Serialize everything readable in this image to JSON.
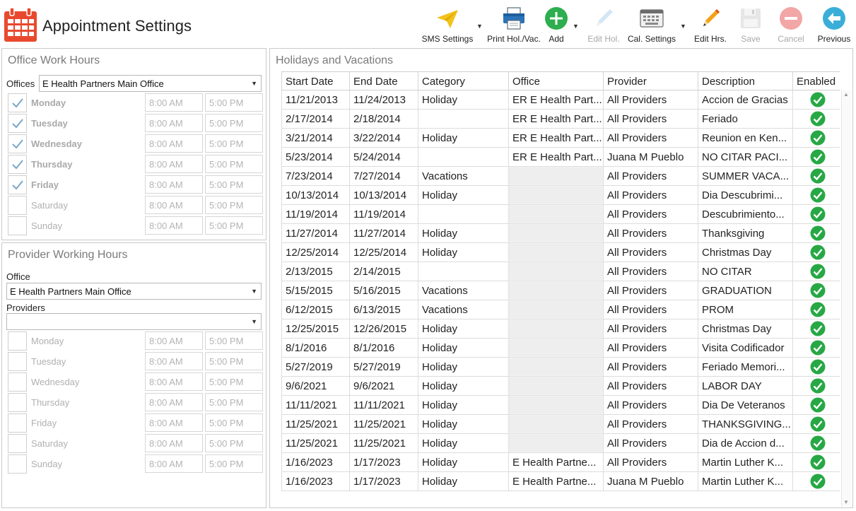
{
  "header": {
    "title": "Appointment Settings",
    "icon": "calendar-icon"
  },
  "toolbar": [
    {
      "label": "SMS Settings",
      "icon": "paper-plane-icon",
      "enabled": true,
      "has_dropdown": true
    },
    {
      "label": "Print Hol./Vac.",
      "icon": "printer-icon",
      "enabled": true,
      "has_dropdown": false
    },
    {
      "label": "Add",
      "icon": "add-circle-icon",
      "enabled": true,
      "has_dropdown": true
    },
    {
      "label": "Edit Hol.",
      "icon": "pencil-icon",
      "enabled": false,
      "has_dropdown": false
    },
    {
      "label": "Cal. Settings",
      "icon": "keyboard-icon",
      "enabled": true,
      "has_dropdown": true
    },
    {
      "label": "Edit Hrs.",
      "icon": "pencil-icon",
      "enabled": true,
      "has_dropdown": false
    },
    {
      "label": "Save",
      "icon": "floppy-disk-icon",
      "enabled": false,
      "has_dropdown": false
    },
    {
      "label": "Cancel",
      "icon": "minus-circle-icon",
      "enabled": false,
      "has_dropdown": false
    },
    {
      "label": "Previous",
      "icon": "arrow-left-circle-icon",
      "enabled": true,
      "has_dropdown": false
    }
  ],
  "office_hours": {
    "title": "Office Work Hours",
    "offices_label": "Offices",
    "office_selected": "E Health Partners Main Office",
    "days": [
      {
        "name": "Monday",
        "checked": true,
        "start": "8:00 AM",
        "end": "5:00 PM"
      },
      {
        "name": "Tuesday",
        "checked": true,
        "start": "8:00 AM",
        "end": "5:00 PM"
      },
      {
        "name": "Wednesday",
        "checked": true,
        "start": "8:00 AM",
        "end": "5:00 PM"
      },
      {
        "name": "Thursday",
        "checked": true,
        "start": "8:00 AM",
        "end": "5:00 PM"
      },
      {
        "name": "Friday",
        "checked": true,
        "start": "8:00 AM",
        "end": "5:00 PM"
      },
      {
        "name": "Saturday",
        "checked": false,
        "start": "8:00 AM",
        "end": "5:00 PM"
      },
      {
        "name": "Sunday",
        "checked": false,
        "start": "8:00 AM",
        "end": "5:00 PM"
      }
    ]
  },
  "provider_hours": {
    "title": "Provider Working Hours",
    "office_label": "Office",
    "office_selected": "E Health Partners Main Office",
    "providers_label": "Providers",
    "provider_selected": "",
    "days": [
      {
        "name": "Monday",
        "checked": false,
        "start": "8:00 AM",
        "end": "5:00 PM"
      },
      {
        "name": "Tuesday",
        "checked": false,
        "start": "8:00 AM",
        "end": "5:00 PM"
      },
      {
        "name": "Wednesday",
        "checked": false,
        "start": "8:00 AM",
        "end": "5:00 PM"
      },
      {
        "name": "Thursday",
        "checked": false,
        "start": "8:00 AM",
        "end": "5:00 PM"
      },
      {
        "name": "Friday",
        "checked": false,
        "start": "8:00 AM",
        "end": "5:00 PM"
      },
      {
        "name": "Saturday",
        "checked": false,
        "start": "8:00 AM",
        "end": "5:00 PM"
      },
      {
        "name": "Sunday",
        "checked": false,
        "start": "8:00 AM",
        "end": "5:00 PM"
      }
    ]
  },
  "holidays": {
    "title": "Holidays and Vacations",
    "columns": [
      "Start Date",
      "End Date",
      "Category",
      "Office",
      "Provider",
      "Description",
      "Enabled"
    ],
    "rows": [
      {
        "start": "11/21/2013",
        "end": "11/24/2013",
        "category": "Holiday",
        "office": "ER E Health Part...",
        "provider": "All Providers",
        "description": "Accion de Gracias",
        "enabled": true
      },
      {
        "start": "2/17/2014",
        "end": "2/18/2014",
        "category": "",
        "office": "ER E Health Part...",
        "provider": "All Providers",
        "description": "Feriado",
        "enabled": true
      },
      {
        "start": "3/21/2014",
        "end": "3/22/2014",
        "category": "Holiday",
        "office": "ER E Health Part...",
        "provider": "All Providers",
        "description": "Reunion en Ken...",
        "enabled": true
      },
      {
        "start": "5/23/2014",
        "end": "5/24/2014",
        "category": "",
        "office": "ER E Health Part...",
        "provider": "Juana M Pueblo",
        "description": "NO CITAR PACI...",
        "enabled": true
      },
      {
        "start": "7/23/2014",
        "end": "7/27/2014",
        "category": "Vacations",
        "office": "",
        "provider": "All Providers",
        "description": "SUMMER VACA...",
        "enabled": true
      },
      {
        "start": "10/13/2014",
        "end": "10/13/2014",
        "category": "Holiday",
        "office": "",
        "provider": "All Providers",
        "description": "Dia Descubrimi...",
        "enabled": true
      },
      {
        "start": "11/19/2014",
        "end": "11/19/2014",
        "category": "",
        "office": "",
        "provider": "All Providers",
        "description": "Descubrimiento...",
        "enabled": true
      },
      {
        "start": "11/27/2014",
        "end": "11/27/2014",
        "category": "Holiday",
        "office": "",
        "provider": "All Providers",
        "description": "Thanksgiving",
        "enabled": true
      },
      {
        "start": "12/25/2014",
        "end": "12/25/2014",
        "category": "Holiday",
        "office": "",
        "provider": "All Providers",
        "description": "Christmas Day",
        "enabled": true
      },
      {
        "start": "2/13/2015",
        "end": "2/14/2015",
        "category": "",
        "office": "",
        "provider": "All Providers",
        "description": "NO CITAR",
        "enabled": true
      },
      {
        "start": "5/15/2015",
        "end": "5/16/2015",
        "category": "Vacations",
        "office": "",
        "provider": "All Providers",
        "description": "GRADUATION",
        "enabled": true
      },
      {
        "start": "6/12/2015",
        "end": "6/13/2015",
        "category": "Vacations",
        "office": "",
        "provider": "All Providers",
        "description": "PROM",
        "enabled": true
      },
      {
        "start": "12/25/2015",
        "end": "12/26/2015",
        "category": "Holiday",
        "office": "",
        "provider": "All Providers",
        "description": "Christmas Day",
        "enabled": true
      },
      {
        "start": "8/1/2016",
        "end": "8/1/2016",
        "category": "Holiday",
        "office": "",
        "provider": "All Providers",
        "description": "Visita Codificador",
        "enabled": true
      },
      {
        "start": "5/27/2019",
        "end": "5/27/2019",
        "category": "Holiday",
        "office": "",
        "provider": "All Providers",
        "description": "Feriado Memori...",
        "enabled": true
      },
      {
        "start": "9/6/2021",
        "end": "9/6/2021",
        "category": "Holiday",
        "office": "",
        "provider": "All Providers",
        "description": "LABOR DAY",
        "enabled": true
      },
      {
        "start": "11/11/2021",
        "end": "11/11/2021",
        "category": "Holiday",
        "office": "",
        "provider": "All Providers",
        "description": "Dia De Veteranos",
        "enabled": true
      },
      {
        "start": "11/25/2021",
        "end": "11/25/2021",
        "category": "Holiday",
        "office": "",
        "provider": "All Providers",
        "description": "THANKSGIVING...",
        "enabled": true
      },
      {
        "start": "11/25/2021",
        "end": "11/25/2021",
        "category": "Holiday",
        "office": "",
        "provider": "All Providers",
        "description": "Dia de Accion d...",
        "enabled": true
      },
      {
        "start": "1/16/2023",
        "end": "1/17/2023",
        "category": "Holiday",
        "office": "E Health Partne...",
        "provider": "All Providers",
        "description": "Martin Luther K...",
        "enabled": true
      },
      {
        "start": "1/16/2023",
        "end": "1/17/2023",
        "category": "Holiday",
        "office": "E Health Partne...",
        "provider": "Juana M Pueblo",
        "description": "Martin Luther K...",
        "enabled": true
      }
    ]
  },
  "colors": {
    "brand_red": "#e8492e",
    "check_green": "#27a845",
    "add_green": "#2eae4f",
    "previous_teal": "#3aaed8",
    "cancel_red": "#f2a6a6",
    "checkbox_check": "#7aa7c7"
  }
}
